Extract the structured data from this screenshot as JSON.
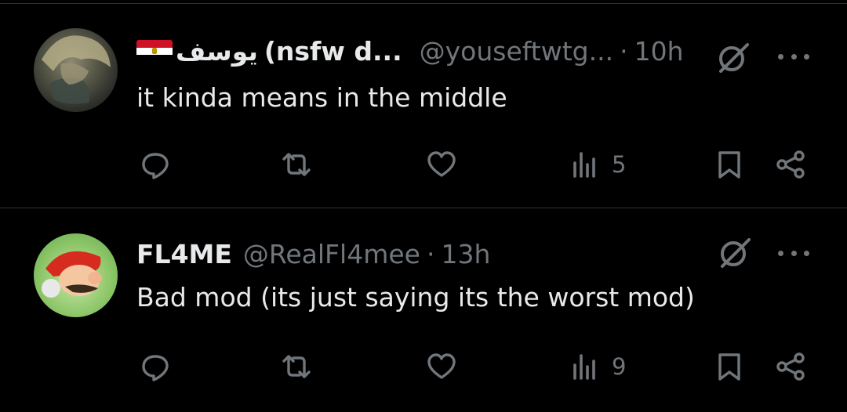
{
  "posts": [
    {
      "display_name_arabic": "يوسف",
      "display_name_rest": "(nsfw d...",
      "handle": "@youseftwtg...",
      "separator": "·",
      "time": "10h",
      "text": "it kinda means in the middle",
      "views": "5",
      "flag": "egypt-flag"
    },
    {
      "display_name": "FL4ME",
      "handle": "@RealFl4mee",
      "separator": "·",
      "time": "13h",
      "text": "Bad mod (its just saying its the worst mod)",
      "views": "9"
    }
  ],
  "colors": {
    "background": "#000000",
    "text_primary": "#e7e9ea",
    "text_secondary": "#71767b",
    "divider": "#2f3336"
  }
}
